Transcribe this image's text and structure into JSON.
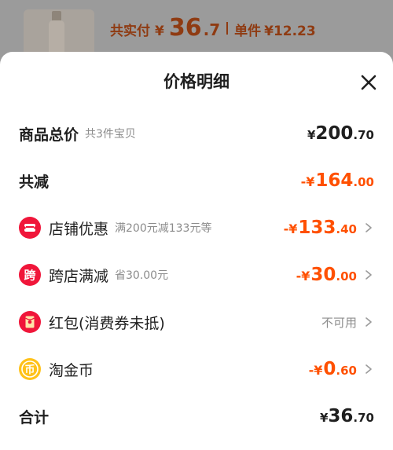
{
  "background": {
    "total_label": "共实付",
    "currency": "¥",
    "total_int": "36",
    "total_dec": ".7",
    "unit_label": "单件",
    "unit_price": "¥12.23"
  },
  "sheet": {
    "title": "价格明细"
  },
  "rows": {
    "goods_total": {
      "label": "商品总价",
      "sublabel": "共3件宝贝",
      "currency": "¥",
      "int": "200",
      "dec": ".70"
    },
    "total_reduction": {
      "label": "共减",
      "prefix": "-¥",
      "int": "164",
      "dec": ".00"
    },
    "store_discount": {
      "label": "店铺优惠",
      "sublabel": "满200元减133元等",
      "prefix": "-¥",
      "int": "133",
      "dec": ".40"
    },
    "cross_store": {
      "label": "跨店满减",
      "icon_text": "跨",
      "sublabel": "省30.00元",
      "prefix": "-¥",
      "int": "30",
      "dec": ".00"
    },
    "red_packet": {
      "label": "红包(消费券未抵)",
      "status": "不可用"
    },
    "taojinbi": {
      "label": "淘金币",
      "icon_text": "币",
      "prefix": "-¥",
      "int": "0",
      "dec": ".60"
    },
    "grand_total": {
      "label": "合计",
      "currency": "¥",
      "int": "36",
      "dec": ".70"
    }
  },
  "icons": {
    "store_discount": "store-coupon-icon",
    "cross_store": "cross-store-icon",
    "red_packet": "red-packet-icon",
    "taojinbi": "coin-icon",
    "close": "close-icon",
    "chevron": "chevron-right-icon"
  },
  "colors": {
    "accent": "#ff5000",
    "icon_red": "#f0163a",
    "coin_yellow": "#ffc21a",
    "muted_text": "#8c8c8c"
  }
}
